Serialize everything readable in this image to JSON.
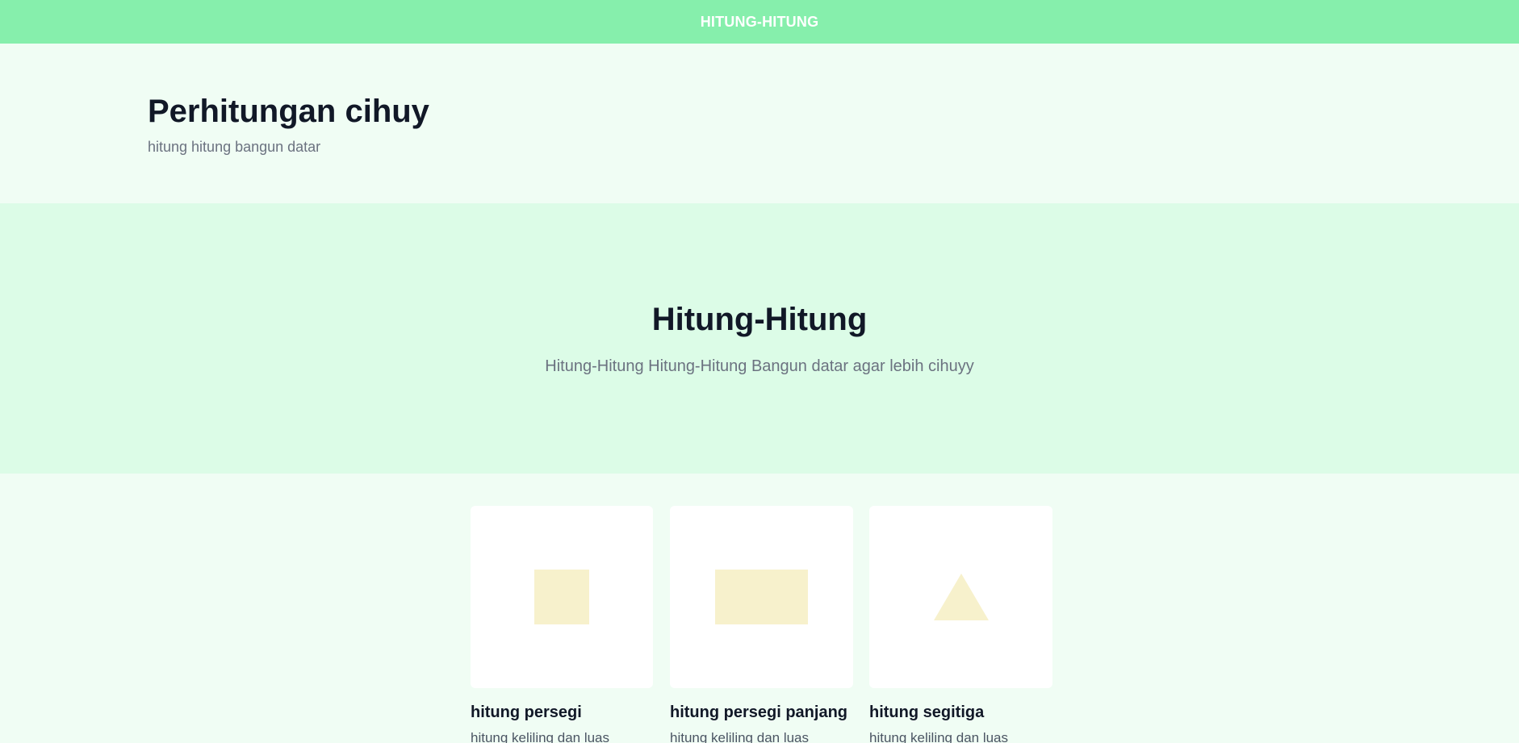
{
  "navbar": {
    "brand": "HITUNG-HITUNG"
  },
  "header": {
    "title": "Perhitungan cihuy",
    "subtitle": "hitung hitung bangun datar"
  },
  "hero": {
    "title": "Hitung-Hitung",
    "subtitle": "Hitung-Hitung Hitung-Hitung Bangun datar agar lebih cihuyy"
  },
  "cards": [
    {
      "title": "hitung persegi",
      "description": "hitung keliling dan luas",
      "icon": "square-shape-icon"
    },
    {
      "title": "hitung persegi panjang",
      "description": "hitung keliling dan luas",
      "icon": "rectangle-shape-icon"
    },
    {
      "title": "hitung segitiga",
      "description": "hitung keliling dan luas",
      "icon": "triangle-shape-icon"
    }
  ],
  "colors": {
    "navbar_bg": "#86efac",
    "page_bg": "#f0fdf4",
    "hero_bg": "#dcfce7",
    "shape_fill": "#f7f1cc",
    "heading": "#111827",
    "muted": "#6b7280"
  }
}
